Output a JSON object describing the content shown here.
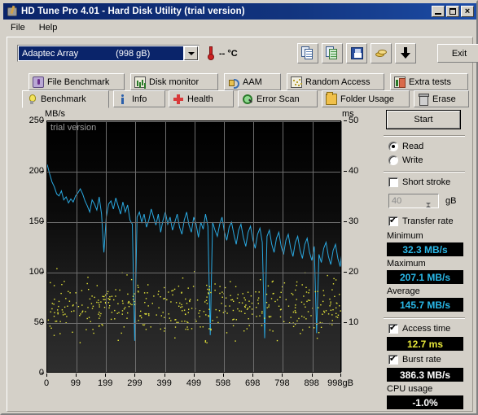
{
  "window": {
    "title": "HD Tune Pro 4.01 - Hard Disk Utility (trial version)",
    "icon": "harddisk-icon",
    "minimize_label": "",
    "maximize_label": "",
    "close_label": "×"
  },
  "menu": {
    "items": [
      {
        "label": "File"
      },
      {
        "label": "Help"
      }
    ]
  },
  "toolbar": {
    "drive_caption": "Adaptec Array",
    "drive_size": "(998 gB)",
    "temperature": "-- °C",
    "buttons": [
      {
        "name": "copy-button",
        "icon": "copy-icon"
      },
      {
        "name": "copy-image-button",
        "icon": "copy-image-icon"
      },
      {
        "name": "save-button",
        "icon": "floppy-save-icon"
      },
      {
        "name": "options-button",
        "icon": "coins-icon"
      },
      {
        "name": "download-button",
        "icon": "down-arrow-icon"
      }
    ],
    "exit_label": "Exit"
  },
  "tabs_top": [
    {
      "label": "File Benchmark",
      "icon": "file-benchmark-icon"
    },
    {
      "label": "Disk monitor",
      "icon": "disk-monitor-icon"
    },
    {
      "label": "AAM",
      "icon": "aam-icon"
    },
    {
      "label": "Random Access",
      "icon": "random-access-icon"
    },
    {
      "label": "Extra tests",
      "icon": "extra-tests-icon"
    }
  ],
  "tabs_bottom": [
    {
      "label": "Benchmark",
      "icon": "benchmark-icon",
      "active": true
    },
    {
      "label": "Info",
      "icon": "info-icon",
      "active": false
    },
    {
      "label": "Health",
      "icon": "health-icon",
      "active": false
    },
    {
      "label": "Error Scan",
      "icon": "error-scan-icon",
      "active": false
    },
    {
      "label": "Folder Usage",
      "icon": "folder-usage-icon",
      "active": false
    },
    {
      "label": "Erase",
      "icon": "erase-icon",
      "active": false
    }
  ],
  "controls": {
    "start_label": "Start",
    "read_label": "Read",
    "write_label": "Write",
    "read_selected": true,
    "short_stroke_label": "Short stroke",
    "short_stroke_checked": false,
    "short_stroke_value": "40",
    "short_stroke_unit": "gB",
    "transfer_rate_label": "Transfer rate",
    "transfer_rate_checked": true,
    "minimum_label": "Minimum",
    "minimum_value": "32.3 MB/s",
    "maximum_label": "Maximum",
    "maximum_value": "207.1 MB/s",
    "average_label": "Average",
    "average_value": "145.7 MB/s",
    "access_time_label": "Access time",
    "access_time_checked": true,
    "access_time_value": "12.7 ms",
    "burst_rate_label": "Burst rate",
    "burst_rate_checked": true,
    "burst_rate_value": "386.3 MB/s",
    "cpu_usage_label": "CPU usage",
    "cpu_usage_value": "-1.0%"
  },
  "colors": {
    "transfer_curve": "#2aa8e0",
    "access_dots": "#e8e83a",
    "plot_background": "#000000",
    "grid": "#6e6e6e",
    "titlebar": "#0a246a",
    "face": "#d4d0c8"
  },
  "chart_data": {
    "type": "line",
    "title": "",
    "watermark": "trial version",
    "xlabel": "",
    "ylabel": "MB/s",
    "y2label": "ms",
    "xlim": [
      0,
      998
    ],
    "ylim": [
      0,
      250
    ],
    "y2lim": [
      0,
      50
    ],
    "grid": true,
    "xticks": [
      "0",
      "99",
      "199",
      "299",
      "399",
      "499",
      "598",
      "698",
      "798",
      "898",
      "998gB"
    ],
    "xtick_values": [
      0,
      99,
      199,
      299,
      399,
      499,
      598,
      698,
      798,
      898,
      998
    ],
    "yticks": [
      "0",
      "50",
      "100",
      "150",
      "200",
      "250"
    ],
    "ytick_values": [
      0,
      50,
      100,
      150,
      200,
      250
    ],
    "y2ticks": [
      "10",
      "20",
      "30",
      "40",
      "50"
    ],
    "y2tick_values": [
      10,
      20,
      30,
      40,
      50
    ],
    "series": [
      {
        "name": "Transfer rate",
        "color": "#2aa8e0",
        "axis": "left",
        "units": "MB/s",
        "x": [
          0,
          8,
          16,
          24,
          32,
          40,
          48,
          56,
          64,
          72,
          80,
          88,
          96,
          104,
          112,
          120,
          128,
          136,
          144,
          152,
          160,
          168,
          176,
          184,
          192,
          200,
          208,
          216,
          224,
          232,
          240,
          248,
          256,
          264,
          272,
          280,
          288,
          296,
          304,
          312,
          320,
          328,
          336,
          344,
          352,
          360,
          368,
          376,
          384,
          392,
          400,
          408,
          416,
          424,
          432,
          440,
          448,
          456,
          464,
          472,
          480,
          488,
          496,
          504,
          512,
          520,
          528,
          536,
          544,
          552,
          560,
          568,
          576,
          584,
          592,
          600,
          608,
          616,
          624,
          632,
          640,
          648,
          656,
          664,
          672,
          680,
          688,
          696,
          704,
          712,
          720,
          728,
          736,
          744,
          752,
          760,
          768,
          776,
          784,
          792,
          800,
          808,
          816,
          824,
          832,
          840,
          848,
          856,
          864,
          872,
          880,
          888,
          896,
          904,
          912,
          920,
          928,
          936,
          944,
          952,
          960,
          968,
          976,
          984,
          992,
          998
        ],
        "y": [
          207.1,
          198,
          190,
          185,
          178,
          176,
          181,
          172,
          175,
          169,
          173,
          170,
          176,
          179,
          183,
          178,
          171,
          166,
          160,
          172,
          168,
          162,
          175,
          158,
          120,
          155,
          168,
          171,
          163,
          174,
          166,
          158,
          170,
          160,
          167,
          152,
          148,
          32.3,
          155,
          160,
          150,
          158,
          145,
          152,
          163,
          155,
          147,
          158,
          140,
          152,
          160,
          148,
          155,
          142,
          150,
          158,
          145,
          138,
          152,
          160,
          147,
          140,
          155,
          148,
          135,
          150,
          143,
          158,
          146,
          38,
          150,
          142,
          136,
          148,
          155,
          140,
          132,
          145,
          150,
          138,
          128,
          142,
          148,
          135,
          126,
          140,
          146,
          133,
          124,
          138,
          144,
          130,
          35,
          136,
          142,
          128,
          120,
          134,
          140,
          126,
          118,
          132,
          138,
          124,
          116,
          130,
          136,
          122,
          114,
          128,
          134,
          120,
          112,
          126,
          40,
          118,
          110,
          124,
          130,
          116,
          108,
          122,
          128,
          114,
          106,
          120,
          126,
          112,
          104,
          95,
          88
        ],
        "note": "declining transfer-rate curve with frequent downward spikes; min 32.3, max 207.1, avg 145.7"
      },
      {
        "name": "Access time",
        "color": "#e8e83a",
        "axis": "right",
        "units": "ms",
        "style": "scatter",
        "mean": 12.7,
        "spread": [
          5,
          22
        ],
        "note": "yellow scatter cloud of random access-time samples across the whole capacity range"
      }
    ],
    "summary": {
      "minimum_mbps": 32.3,
      "maximum_mbps": 207.1,
      "average_mbps": 145.7,
      "access_time_ms": 12.7,
      "burst_rate_mbps": 386.3,
      "cpu_usage_percent": -1.0
    }
  }
}
